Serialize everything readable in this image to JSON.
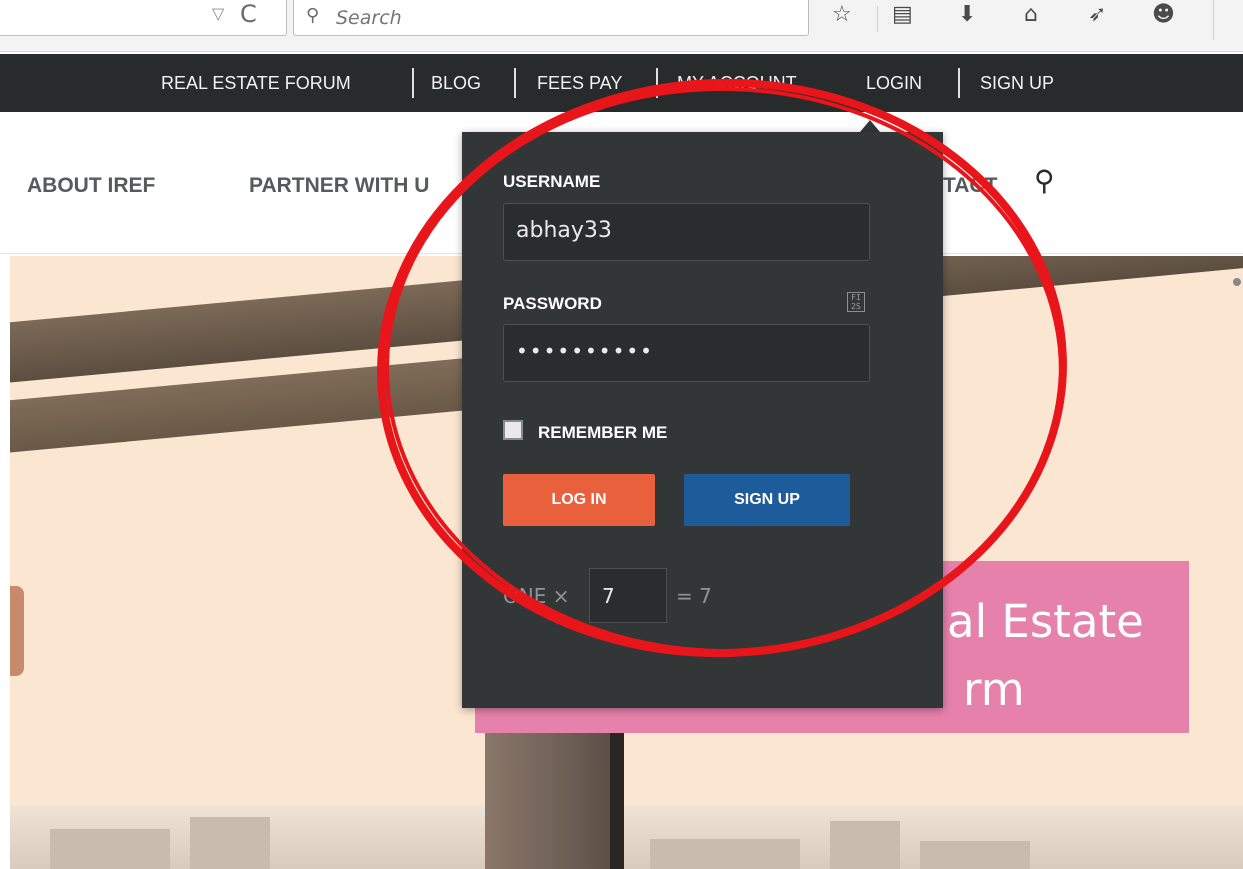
{
  "browser": {
    "search_placeholder": "Search",
    "icons": [
      "dropmarker-icon",
      "reload-icon",
      "search-icon",
      "bookmark-star-icon",
      "reading-list-icon",
      "downloads-icon",
      "home-icon",
      "share-icon",
      "hello-icon"
    ]
  },
  "topnav": {
    "items": [
      "REAL ESTATE FORUM",
      "BLOG",
      "FEES PAY",
      "MY ACCOUNT",
      "LOGIN",
      "SIGN UP"
    ]
  },
  "mainnav": {
    "about": "ABOUT IREF",
    "partner": "PARTNER WITH U",
    "contact": "TACT"
  },
  "hero": {
    "promo_line1": "al Estate",
    "promo_line2": "rm",
    "promo_color": "#e681ac"
  },
  "login": {
    "username_label": "USERNAME",
    "username_value": "abhay33",
    "password_label": "PASSWORD",
    "password_value": "••••••••••",
    "password_badge": "FI 2S",
    "remember_label": "REMEMBER ME",
    "login_button": "LOG IN",
    "signup_button": "SIGN UP",
    "captcha_prefix": "ONE ×",
    "captcha_value": "7",
    "captcha_suffix": "= 7",
    "login_color": "#e9613c",
    "signup_color": "#1e5b9a"
  },
  "annotation_color": "#e8151b"
}
